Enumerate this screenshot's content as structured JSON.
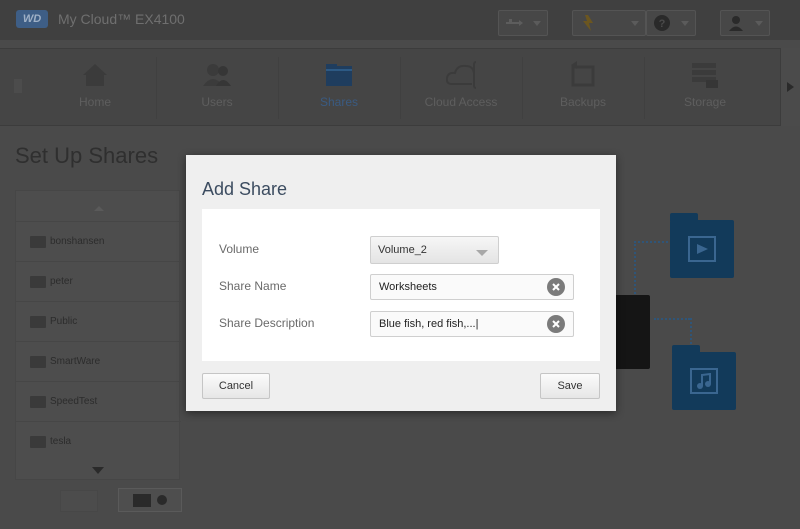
{
  "header": {
    "logo_text": "WD",
    "product": "My Cloud™ EX4100",
    "buttons": [
      {
        "name": "usb-button",
        "icon": "usb-icon"
      },
      {
        "name": "alerts-button",
        "icon": "alert-icon"
      },
      {
        "name": "help-button",
        "icon": "help-icon"
      },
      {
        "name": "user-button",
        "icon": "user-icon"
      }
    ]
  },
  "nav": {
    "items": [
      {
        "label": "Home",
        "icon": "home-icon"
      },
      {
        "label": "Users",
        "icon": "users-icon"
      },
      {
        "label": "Shares",
        "icon": "shares-icon",
        "active": true
      },
      {
        "label": "Cloud Access",
        "icon": "cloud-access-icon"
      },
      {
        "label": "Backups",
        "icon": "backups-icon"
      },
      {
        "label": "Storage",
        "icon": "storage-icon"
      }
    ]
  },
  "page": {
    "title": "Set Up Shares",
    "shares": [
      "bonshansen",
      "peter",
      "Public",
      "SmartWare",
      "SpeedTest",
      "tesla"
    ]
  },
  "modal": {
    "title": "Add Share",
    "volume_label": "Volume",
    "volume_value": "Volume_2",
    "share_name_label": "Share Name",
    "share_name_value": "Worksheets",
    "share_desc_label": "Share Description",
    "share_desc_value": "Blue fish, red fish,...|",
    "cancel_label": "Cancel",
    "save_label": "Save"
  },
  "colors": {
    "accent": "#0b7bc0",
    "dim_overlay": "#4a4a4a",
    "dialog_bg": "#efefef"
  }
}
